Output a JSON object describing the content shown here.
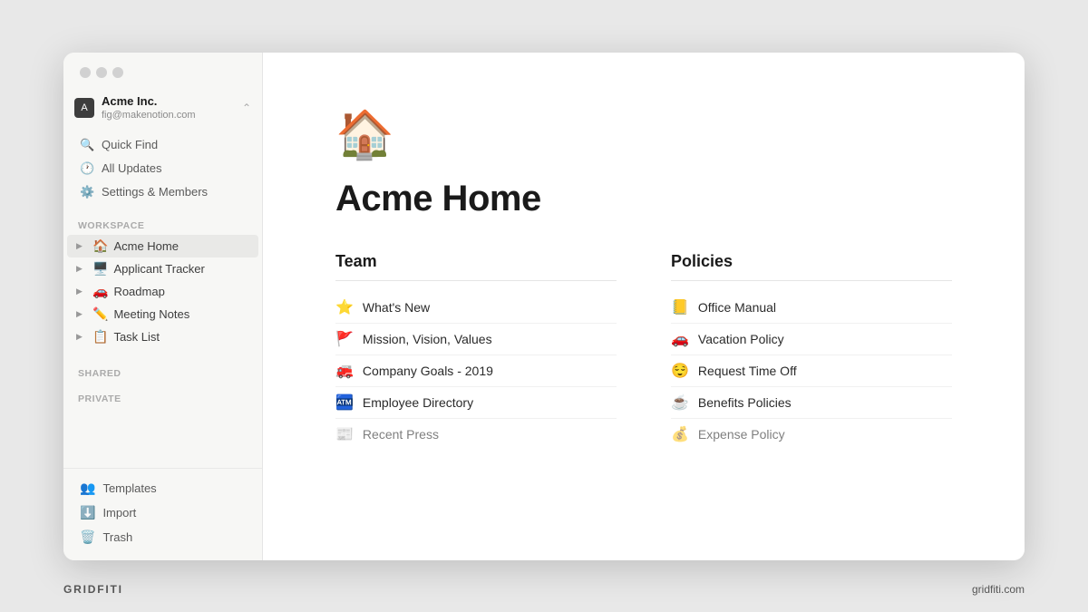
{
  "window": {
    "title": "Acme Home"
  },
  "sidebar": {
    "account": {
      "name": "Acme Inc.",
      "email": "fig@makenotion.com",
      "icon": "A"
    },
    "nav_items": [
      {
        "id": "quick-find",
        "icon": "🔍",
        "label": "Quick Find"
      },
      {
        "id": "all-updates",
        "icon": "🕐",
        "label": "All Updates"
      },
      {
        "id": "settings",
        "icon": "⚙️",
        "label": "Settings & Members"
      }
    ],
    "section_workspace": "WORKSPACE",
    "workspace_items": [
      {
        "id": "acme-home",
        "emoji": "🏠",
        "label": "Acme Home",
        "active": true
      },
      {
        "id": "applicant-tracker",
        "emoji": "🖥️",
        "label": "Applicant Tracker",
        "active": false
      },
      {
        "id": "roadmap",
        "emoji": "🚗",
        "label": "Roadmap",
        "active": false
      },
      {
        "id": "meeting-notes",
        "emoji": "✏️",
        "label": "Meeting Notes",
        "active": false
      },
      {
        "id": "task-list",
        "emoji": "📋",
        "label": "Task List",
        "active": false
      }
    ],
    "section_shared": "SHARED",
    "section_private": "PRIVATE",
    "bottom_items": [
      {
        "id": "templates",
        "emoji": "👥",
        "label": "Templates"
      },
      {
        "id": "import",
        "emoji": "⬇️",
        "label": "Import"
      },
      {
        "id": "trash",
        "emoji": "🗑️",
        "label": "Trash"
      }
    ]
  },
  "page": {
    "icon": "🏠",
    "title": "Acme Home",
    "team_column": {
      "heading": "Team",
      "items": [
        {
          "emoji": "⭐",
          "label": "What's New"
        },
        {
          "emoji": "🚩",
          "label": "Mission, Vision, Values"
        },
        {
          "emoji": "🚒",
          "label": "Company Goals - 2019"
        },
        {
          "emoji": "🏧",
          "label": "Employee Directory"
        },
        {
          "emoji": "📰",
          "label": "Recent Press"
        }
      ]
    },
    "policies_column": {
      "heading": "Policies",
      "items": [
        {
          "emoji": "📒",
          "label": "Office Manual"
        },
        {
          "emoji": "🚗",
          "label": "Vacation Policy"
        },
        {
          "emoji": "😌",
          "label": "Request Time Off"
        },
        {
          "emoji": "☕",
          "label": "Benefits Policies"
        },
        {
          "emoji": "💰",
          "label": "Expense Policy"
        }
      ]
    }
  },
  "footer": {
    "brand_left": "GRIDFITI",
    "brand_right": "gridfiti.com"
  }
}
